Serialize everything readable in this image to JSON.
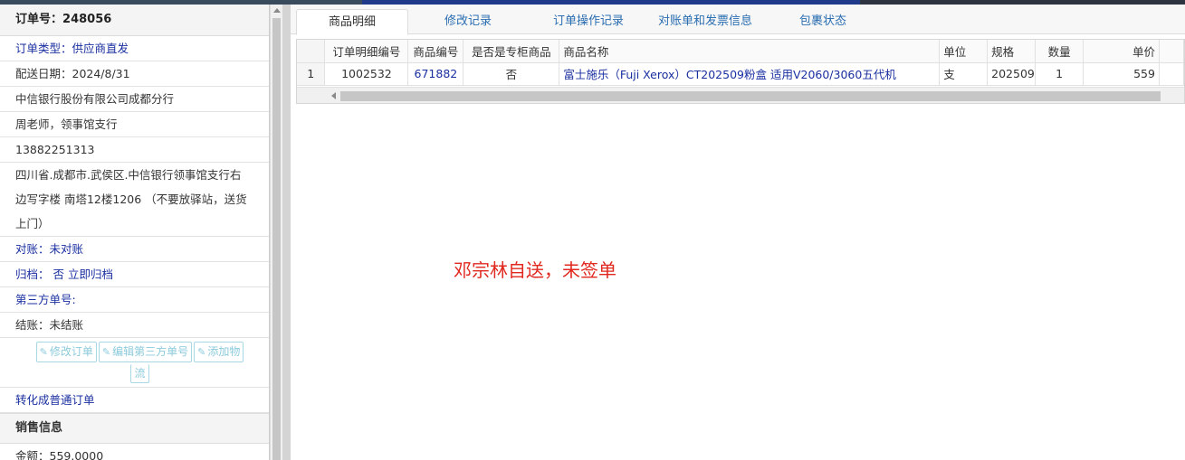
{
  "left": {
    "order_label": "订单号",
    "order_number": "248056",
    "order_type_label": "订单类型",
    "order_type_value": "供应商直发",
    "delivery_date": "配送日期：2024/8/31",
    "company": "中信银行股份有限公司成都分行",
    "contact": "周老师，领事馆支行",
    "phone": "13882251313",
    "address_1": "四川省.成都市.武侯区.中信银行领事馆支行右",
    "address_2": "边写字楼 南塔12楼1206 （不要放驿站，送货",
    "address_3": "上门）",
    "reconcile_label": "对账",
    "reconcile_value": "未对账",
    "archive_label": "归档",
    "archive_value": "否 立即归档",
    "third_party": "第三方单号:",
    "settle": "结账：未结账",
    "btn_edit_order": "修改订单",
    "btn_edit_third": "编辑第三方单号",
    "btn_add_logistics_1": "添加物",
    "btn_add_logistics_2": "流",
    "convert": "转化成普通订单",
    "sales_section": "销售信息",
    "amount": "金额：559.0000"
  },
  "tabs": [
    "商品明细",
    "修改记录",
    "订单操作记录",
    "对账单和发票信息",
    "包裹状态"
  ],
  "grid": {
    "headers": [
      "订单明细编号",
      "商品编号",
      "是否是专柜商品",
      "商品名称",
      "单位",
      "规格",
      "数量",
      "单价"
    ],
    "rows": [
      {
        "index": "1",
        "detail_id": "1002532",
        "product_id": "671882",
        "is_counter": "否",
        "product_name": "富士施乐（Fuji Xerox）CT202509粉盒 适用V2060/3060五代机",
        "unit": "支",
        "spec": "202509",
        "qty": "1",
        "price": "559"
      }
    ]
  },
  "note": "邓宗林自送，未签单",
  "colors": {
    "link": "#1a2fa0",
    "note": "#e0281e",
    "button_border": "#a8d8e4"
  },
  "icons": {
    "edit": "edit-icon"
  }
}
